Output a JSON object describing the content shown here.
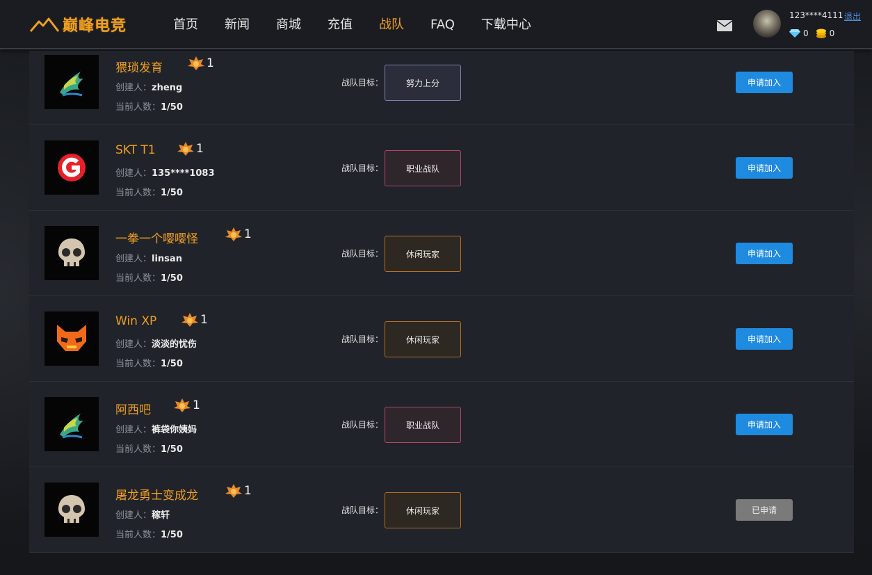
{
  "header": {
    "logo_text": "巅峰电竞",
    "nav": [
      "首页",
      "新闻",
      "商城",
      "充值",
      "战队",
      "FAQ",
      "下载中心"
    ],
    "active_nav_index": 4,
    "user": {
      "name": "123****4111",
      "logout_label": "退出",
      "diamonds": "0",
      "coins": "0"
    }
  },
  "labels": {
    "creator": "创建人：",
    "members": "当前人数：",
    "goal": "战队目标："
  },
  "teams": [
    {
      "name": "猥琐发育",
      "rank": "1",
      "creator": "zheng",
      "members": "1/50",
      "goal": "努力上分",
      "goal_style": "blue",
      "logo": "dragon-logo",
      "action": "申请加入",
      "applied": false
    },
    {
      "name": "SKT T1",
      "rank": "1",
      "creator": "135****1083",
      "members": "1/50",
      "goal": "职业战队",
      "goal_style": "red",
      "logo": "g-logo",
      "action": "申请加入",
      "applied": false
    },
    {
      "name": "一拳一个嘤嘤怪",
      "rank": "1",
      "creator": "linsan",
      "members": "1/50",
      "goal": "休闲玩家",
      "goal_style": "orange",
      "logo": "skull-logo",
      "action": "申请加入",
      "applied": false
    },
    {
      "name": "Win XP",
      "rank": "1",
      "creator": "淡淡的忧伤",
      "members": "1/50",
      "goal": "休闲玩家",
      "goal_style": "orange",
      "logo": "cat-logo",
      "action": "申请加入",
      "applied": false
    },
    {
      "name": "阿西吧",
      "rank": "1",
      "creator": "裤袋你姨妈",
      "members": "1/50",
      "goal": "职业战队",
      "goal_style": "red",
      "logo": "dragon-logo",
      "action": "申请加入",
      "applied": false
    },
    {
      "name": "屠龙勇士变成龙",
      "rank": "1",
      "creator": "稼轩",
      "members": "1/50",
      "goal": "休闲玩家",
      "goal_style": "orange",
      "logo": "skull-logo",
      "action": "已申请",
      "applied": true
    }
  ],
  "colors": {
    "accent": "#f0a020",
    "button": "#1f8be0",
    "button_disabled": "#7a7a7a"
  }
}
